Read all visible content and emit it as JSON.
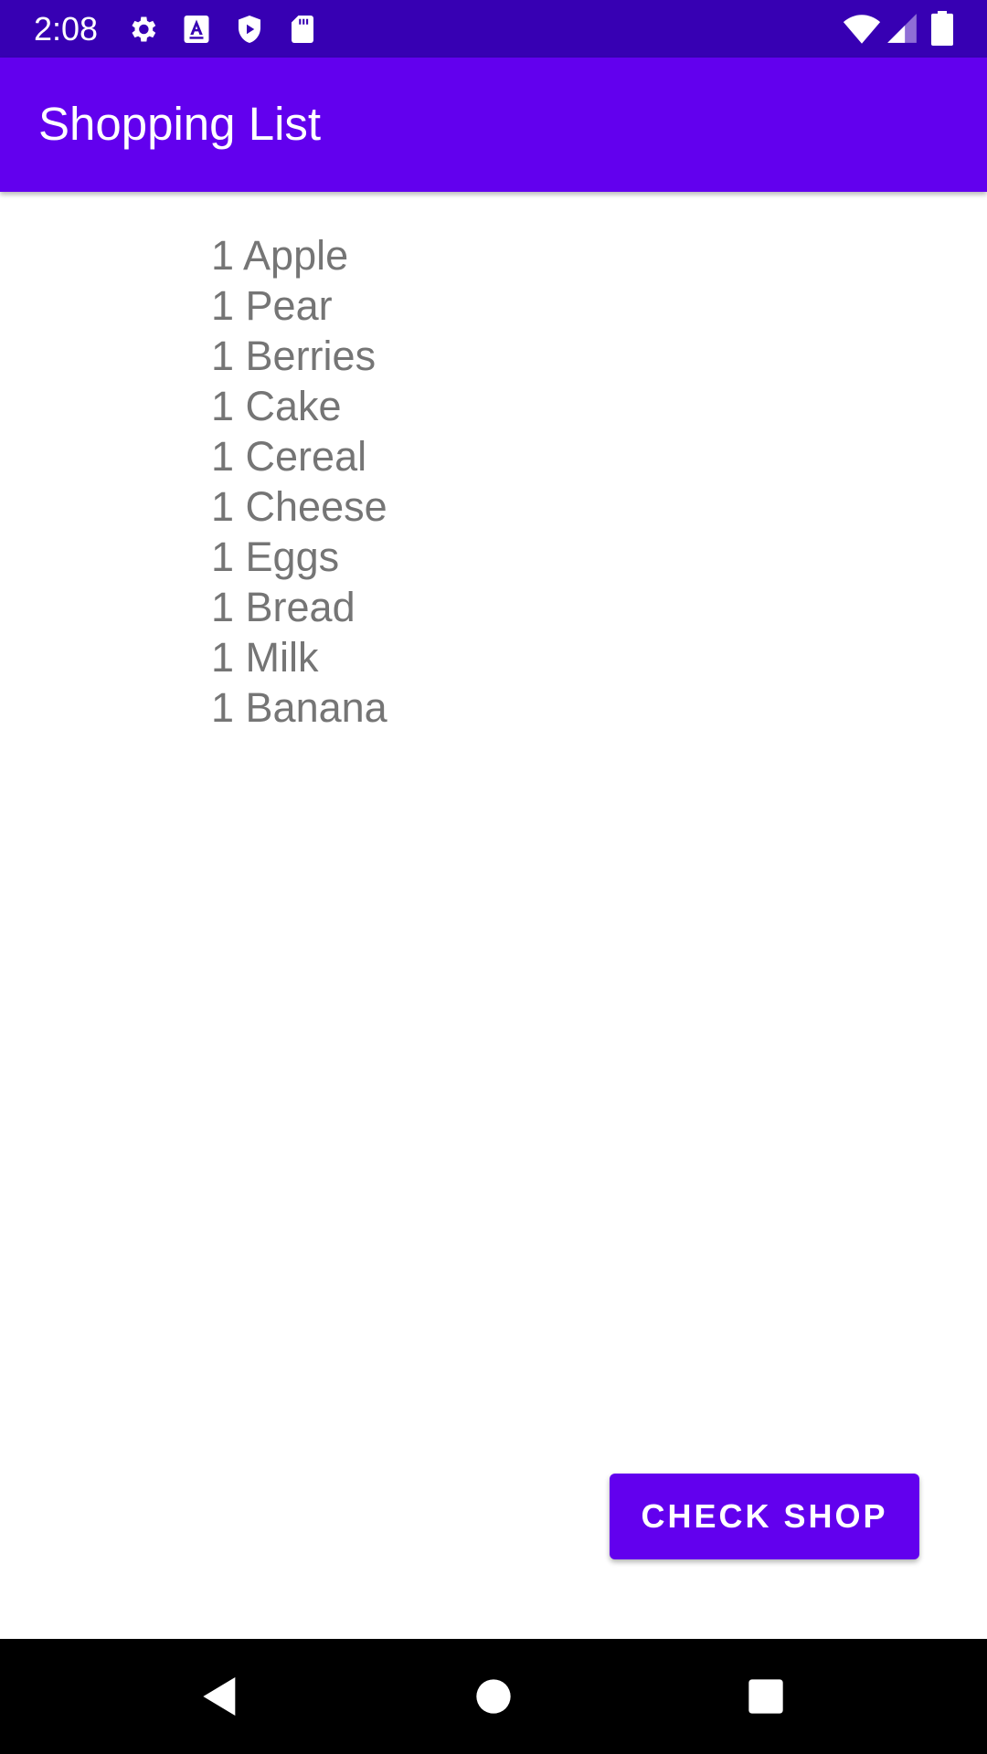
{
  "status_bar": {
    "time": "2:08",
    "icons": [
      "gear-icon",
      "font-a-icon",
      "shield-play-icon",
      "sd-card-icon",
      "wifi-icon",
      "cell-signal-icon",
      "battery-icon"
    ]
  },
  "app_bar": {
    "title": "Shopping List"
  },
  "shopping_list": {
    "items": [
      "1 Apple",
      "1 Pear",
      "1 Berries",
      "1 Cake",
      "1 Cereal",
      "1 Cheese",
      "1 Eggs",
      "1 Bread",
      "1 Milk",
      "1 Banana"
    ]
  },
  "check_shop_button": {
    "label": "CHECK SHOP"
  },
  "nav_bar": {
    "icons": [
      "back-icon",
      "home-icon",
      "recents-icon"
    ]
  },
  "colors": {
    "status_bar": "#3700b3",
    "primary": "#6200ee",
    "list_text": "#757575",
    "nav_bar": "#000000"
  }
}
